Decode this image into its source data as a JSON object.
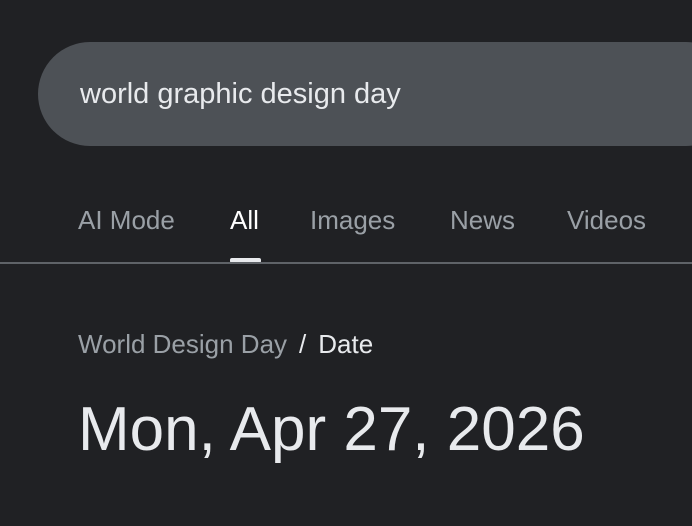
{
  "search": {
    "query": "world graphic design day"
  },
  "tabs": [
    {
      "label": "AI Mode",
      "active": false
    },
    {
      "label": "All",
      "active": true
    },
    {
      "label": "Images",
      "active": false
    },
    {
      "label": "News",
      "active": false
    },
    {
      "label": "Videos",
      "active": false
    }
  ],
  "breadcrumb": {
    "parent": "World Design Day",
    "separator": "/",
    "current": "Date"
  },
  "answer": {
    "value": "Mon, Apr 27, 2026"
  },
  "colors": {
    "background": "#202124",
    "search_box": "#4d5156",
    "text_primary": "#e8eaed",
    "text_secondary": "#9aa0a6"
  }
}
